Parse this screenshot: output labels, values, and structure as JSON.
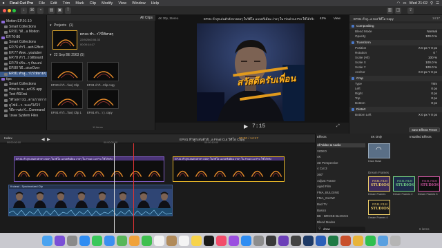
{
  "menubar": {
    "app": "Final Cut Pro",
    "items": [
      "File",
      "Edit",
      "Trim",
      "Mark",
      "Clip",
      "Modify",
      "View",
      "Window",
      "Help"
    ],
    "clock": "Wed 21:02"
  },
  "libraries": {
    "rows": [
      {
        "label": "Motion EP.01-10",
        "indent": 0,
        "sel": false
      },
      {
        "label": "Smart Collections",
        "indent": 1,
        "sel": false
      },
      {
        "label": "EP.01 วิดี...a Motion",
        "indent": 1,
        "sel": false
      },
      {
        "label": "EP.76-86",
        "indent": 0,
        "sel": false
      },
      {
        "label": "Smart Collections",
        "indent": 1,
        "sel": false
      },
      {
        "label": "EP.76 ทำวี...ash Effect",
        "indent": 1,
        "sel": false
      },
      {
        "label": "EP.77 ตัดต...youtuber",
        "indent": 1,
        "sel": false
      },
      {
        "label": "EP.78 ทำวิ...t billboard",
        "indent": 1,
        "sel": false
      },
      {
        "label": "EP.79 ปรับ...ๆ กันแอป",
        "indent": 1,
        "sel": false
      },
      {
        "label": "EP.80 วิธี...oiceOver",
        "indent": 1,
        "sel": false
      },
      {
        "label": "EP.81 ทำสู...าไว้ให้หายๆ",
        "indent": 1,
        "sel": true
      },
      {
        "label": "tips",
        "indent": 0,
        "sel": false
      },
      {
        "label": "Smart Collections",
        "indent": 1,
        "sel": false
      },
      {
        "label": "How to re...acOS app",
        "indent": 1,
        "sel": false
      },
      {
        "label": "Test ที่นี่ใหม่",
        "indent": 1,
        "sel": false
      },
      {
        "label": "วิดีโอทาวน์...ตามรายการ",
        "indent": 1,
        "sel": false
      },
      {
        "label": "ดูไฟล์...ว. จะแก้ได้ไว้",
        "indent": 1,
        "sel": false
      },
      {
        "label": "วิธีการส่ง K...Command",
        "indent": 1,
        "sel": false
      },
      {
        "label": "โหลด System Files",
        "indent": 1,
        "sel": false
      }
    ]
  },
  "browser": {
    "filter": "All Clips",
    "projects_label": "Projects",
    "projects_count": "(1)",
    "project_name": "EP.81 ทำ...าไว้ให้หายๆ",
    "project_meta1": "22/9/2563 06.33",
    "project_meta2": "00:00:14:17",
    "date_label": "22 Sep BE 2563",
    "date_count": "(5)",
    "clips": [
      "EP.80 ทำวิ...วัดย) Clip",
      "EP.81 ทำวิ...Clip copy",
      "EP.81 ทำวิ...วัดย) Clip 1",
      "EP.81 ทำ...า ). copy"
    ],
    "items_count": "11 items"
  },
  "viewer": {
    "format": "4K 30p, Stereo",
    "title": "EP.81 ทำสูกเล่นตัวอักษรลอยๆ ในวิดีโอ แบบพรีเมียม ง่ายๆ ใน Final Cut Pro ใช้ได้จริง",
    "zoom": "43%",
    "view_menu": "View",
    "overlay_text": "สวัสดีครับเพื่อน",
    "timecode": "7:15"
  },
  "inspector": {
    "title": "EP.81 ทำสู...a Cut วิดีโอ Copy",
    "duration": "14:17",
    "compositing": "Compositing",
    "blend_mode_label": "Blend Mode",
    "blend_mode": "Normal",
    "opacity_label": "Opacity",
    "opacity": "100.0 %",
    "transform": "Transform",
    "position_label": "Position",
    "position": "X  0 px   Y  0 px",
    "rotation_label": "Rotation",
    "rotation": "0 °",
    "scale_all_label": "Scale (All)",
    "scale_all": "100 %",
    "scale_x_label": "Scale X",
    "scale_x": "100.0 %",
    "scale_y_label": "Scale Y",
    "scale_y": "100.0 %",
    "anchor_label": "Anchor",
    "anchor": "X  0 px   Y  0 px",
    "crop": "Crop",
    "type_label": "Type",
    "type": "Trim",
    "left_label": "Left",
    "left": "0 px",
    "right_label": "Right",
    "right": "0 px",
    "top_label": "Top",
    "top": "0 px",
    "bottom_label": "Bottom",
    "bottom": "0 px",
    "distort": "Distort",
    "bottom_left_label": "Bottom Left",
    "bottom_left": "X  0 px   Y  0 px",
    "save_preset": "Save Effects Preset"
  },
  "timeline": {
    "index": "Index",
    "project": "EP.81 ทำสูกเล่นตัวอั...a Final Cut วิดีโอ Copy",
    "duration": "00:00 / 14:17",
    "ticks": [
      "00:00:00:00",
      "00:00:05:00",
      "00:00:10:00"
    ],
    "clip_title": "EP.81 ทำสูกเล่นตัวอักษร ลอยๆ ในวิดีโอ แบบพรีเมียม ง่ายๆ ใน Final Cut Pro ใช้ได้จริง",
    "clip_title_right": "EP.81 ทำสูกเล่นตัวอักษร ลอยๆ ในวิดีโอ แบบพรีเมียม ง่ายๆ ใน Final Cut Pro ใช้ได้จริง",
    "audio_label": "Krulead - Synchronized Clip"
  },
  "effects": {
    "header": "Effects",
    "filter": "4K Only",
    "installed": "Installed Effects",
    "categories": [
      "All Video & Audio",
      "VIDEO",
      "4K",
      "3D Perspective",
      "4 Cut 3",
      "360°",
      "Adjust Frame",
      "Aged Film",
      "FMA_BULGING",
      "FMA_GLOW",
      "Bad TV",
      "Basics",
      "BE - BROKE BLOCKS",
      "Blend Modes"
    ],
    "effects": [
      {
        "name": "Draw Mask",
        "style": "mask"
      },
      {
        "name": "Dream Frames",
        "style": "pfs1"
      },
      {
        "name": "Dream Frames 2",
        "style": "pfs2"
      },
      {
        "name": "Dream Frames 3",
        "style": "pfs3"
      },
      {
        "name": "Dream Frames 4",
        "style": "pfs4"
      }
    ],
    "section": "Dream Frames",
    "tile_brand_1": "PIXEL FILM",
    "tile_brand_2": "STUDIOS",
    "search": "draw",
    "count": "6 items"
  },
  "colors": {
    "accent_text": "#ffb21f",
    "clip_purple": "#4b3478",
    "selection_blue": "#3b5a8a",
    "clip_yellow_border": "#e5b428"
  }
}
